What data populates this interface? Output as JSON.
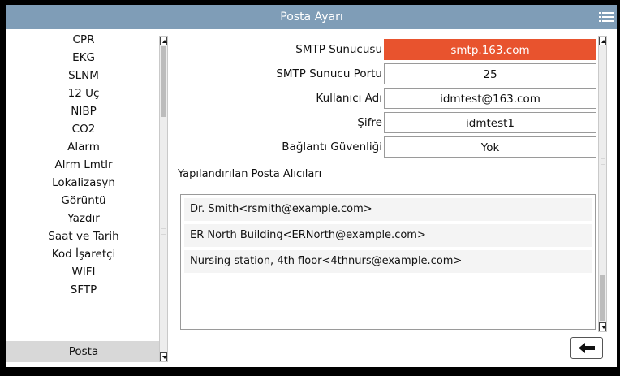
{
  "header": {
    "title": "Posta Ayarı",
    "menu_icon": "hamburger-menu-icon"
  },
  "sidebar": {
    "items": [
      {
        "label": "CPR"
      },
      {
        "label": "EKG"
      },
      {
        "label": "SLNM"
      },
      {
        "label": "12 Uç"
      },
      {
        "label": "NIBP"
      },
      {
        "label": "CO2"
      },
      {
        "label": "Alarm"
      },
      {
        "label": "Alrm Lmtlr"
      },
      {
        "label": "Lokalizasyn"
      },
      {
        "label": "Görüntü"
      },
      {
        "label": "Yazdır"
      },
      {
        "label": "Saat ve Tarih"
      },
      {
        "label": "Kod İşaretçi"
      },
      {
        "label": "WIFI"
      },
      {
        "label": "SFTP"
      },
      {
        "label": "Posta"
      }
    ],
    "selected": "Posta"
  },
  "settings": {
    "fields": [
      {
        "label": "SMTP Sunucusu",
        "value": "smtp.163.com"
      },
      {
        "label": "SMTP Sunucu Portu",
        "value": "25"
      },
      {
        "label": "Kullanıcı Adı",
        "value": "idmtest@163.com"
      },
      {
        "label": "Şifre",
        "value": "idmtest1"
      },
      {
        "label": "Bağlantı Güvenliği",
        "value": "Yok"
      }
    ],
    "active_field_color": "#e8532e"
  },
  "recipients": {
    "label": "Yapılandırılan Posta Alıcıları",
    "items": [
      "Dr. Smith<rsmith@example.com>",
      "ER North Building<ERNorth@example.com>",
      "Nursing station, 4th floor<4thnurs@example.com>"
    ]
  },
  "footer": {
    "back_icon": "back-arrow-icon"
  },
  "colors": {
    "titlebar": "#7f9db7",
    "selected_item": "#d8d8d8"
  }
}
